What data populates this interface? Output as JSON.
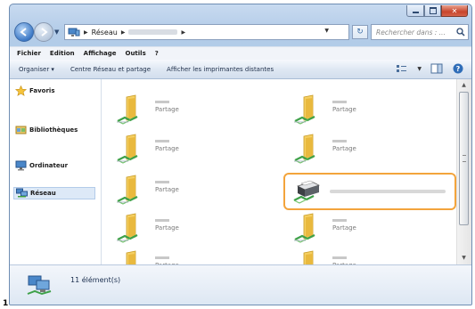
{
  "step_number": "1",
  "address": {
    "segment1": "Réseau",
    "search_placeholder": "Rechercher dans : ... "
  },
  "menu": [
    "Fichier",
    "Edition",
    "Affichage",
    "Outils",
    "?"
  ],
  "toolbar": {
    "organize": "Organiser ▾",
    "network_center": "Centre Réseau et partage",
    "show_printers": "Afficher les imprimantes distantes"
  },
  "nav": {
    "favorites": "Favoris",
    "libraries": "Bibliothèques",
    "computer": "Ordinateur",
    "network": "Réseau"
  },
  "items": [
    {
      "label": "Partage"
    },
    {
      "label": "Partage"
    },
    {
      "label": "Partage"
    },
    {
      "label": "Partage"
    },
    {
      "label": "Partage"
    },
    {
      "label": "Partage"
    },
    {
      "label": "Partage"
    },
    {
      "label": "Partage"
    },
    {
      "label": "Partage"
    }
  ],
  "status": {
    "count": "11 élément(s)"
  },
  "colors": {
    "highlight": "#f3a43c",
    "accent": "#3d79c6"
  }
}
